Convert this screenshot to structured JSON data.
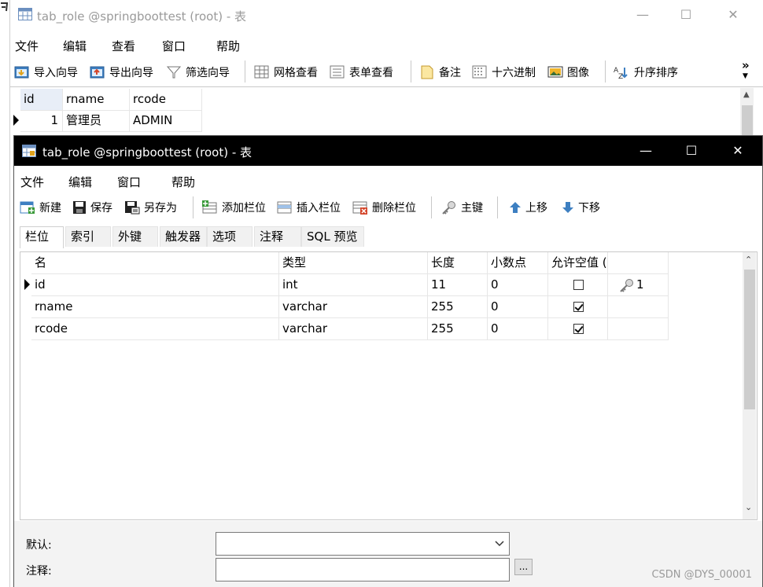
{
  "bg_window": {
    "title": "tab_role @springboottest (root) - 表",
    "menu": [
      "文件",
      "编辑",
      "查看",
      "窗口",
      "帮助"
    ],
    "toolbar": [
      {
        "label": "导入向导",
        "icon": "import-wizard-icon"
      },
      {
        "label": "导出向导",
        "icon": "export-wizard-icon"
      },
      {
        "label": "筛选向导",
        "icon": "filter-wizard-icon"
      },
      {
        "label": "网格查看",
        "icon": "grid-view-icon"
      },
      {
        "label": "表单查看",
        "icon": "form-view-icon"
      },
      {
        "label": "备注",
        "icon": "memo-icon"
      },
      {
        "label": "十六进制",
        "icon": "hex-icon"
      },
      {
        "label": "图像",
        "icon": "image-icon"
      },
      {
        "label": "升序排序",
        "icon": "sort-asc-icon"
      }
    ],
    "overflow": "»",
    "grid": {
      "columns": [
        "id",
        "rname",
        "rcode"
      ],
      "rows": [
        {
          "id": "1",
          "rname": "管理员",
          "rcode": "ADMIN"
        }
      ]
    }
  },
  "fg_window": {
    "title": "tab_role @springboottest (root) - 表",
    "menu": [
      "文件",
      "编辑",
      "窗口",
      "帮助"
    ],
    "toolbar": [
      {
        "label": "新建",
        "icon": "new-icon"
      },
      {
        "label": "保存",
        "icon": "save-icon"
      },
      {
        "label": "另存为",
        "icon": "save-as-icon"
      },
      {
        "label": "添加栏位",
        "icon": "add-field-icon"
      },
      {
        "label": "插入栏位",
        "icon": "insert-field-icon"
      },
      {
        "label": "删除栏位",
        "icon": "delete-field-icon"
      },
      {
        "label": "主键",
        "icon": "primary-key-icon"
      },
      {
        "label": "上移",
        "icon": "arrow-up-icon"
      },
      {
        "label": "下移",
        "icon": "arrow-down-icon"
      }
    ],
    "tabs": [
      "栏位",
      "索引",
      "外键",
      "触发器",
      "选项",
      "注释",
      "SQL 预览"
    ],
    "active_tab": "栏位",
    "fields": {
      "columns": [
        "名",
        "类型",
        "长度",
        "小数点",
        "允许空值 ("
      ],
      "rows": [
        {
          "name": "id",
          "type": "int",
          "length": "11",
          "decimals": "0",
          "nullable": false,
          "key": "1"
        },
        {
          "name": "rname",
          "type": "varchar",
          "length": "255",
          "decimals": "0",
          "nullable": true,
          "key": ""
        },
        {
          "name": "rcode",
          "type": "varchar",
          "length": "255",
          "decimals": "0",
          "nullable": true,
          "key": ""
        }
      ]
    },
    "default_label": "默认:",
    "default_value": "",
    "comment_label": "注释:",
    "comment_value": "",
    "dots_label": "..."
  },
  "watermark": "CSDN @DYS_00001",
  "colors": {
    "fg_titlebar": "#000000",
    "bg_titlebar_text": "#9a9a9a",
    "grid_border": "#e6e6e6"
  }
}
